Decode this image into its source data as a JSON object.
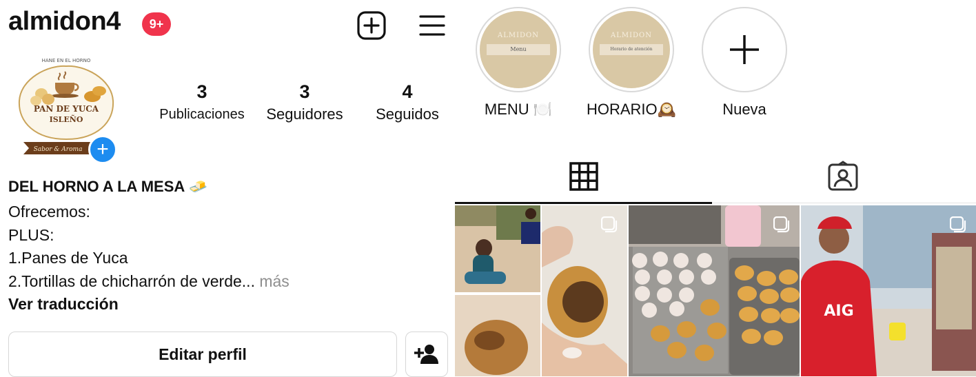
{
  "header": {
    "username": "almidon4",
    "notification_badge": "9+"
  },
  "profile": {
    "avatar": {
      "top_text": "HANE EN EL HORNO",
      "line1": "PAN DE YUCA",
      "line2": "ISLEÑO",
      "ribbon": "Sabor & Aroma"
    },
    "stats": [
      {
        "value": "3",
        "label": "Publicaciones"
      },
      {
        "value": "3",
        "label": "Seguidores"
      },
      {
        "value": "4",
        "label": "Seguidos"
      }
    ],
    "bio": {
      "name": "DEL HORNO A LA MESA",
      "name_emoji": "🧈",
      "lines": [
        "Ofrecemos:",
        "PLUS:",
        "1.Panes de Yuca",
        "2.Tortillas de chicharrón de verde..."
      ],
      "more": "más",
      "translate": "Ver traducción"
    },
    "edit_button": "Editar perfil"
  },
  "highlights": [
    {
      "label": "MENU 🍽️",
      "cover_brand": "ALMIDON",
      "cover_text": "Menu"
    },
    {
      "label": "HORARIO🕰️",
      "cover_brand": "ALMIDON",
      "cover_text": "Horario de atención"
    },
    {
      "label": "Nueva"
    }
  ],
  "grid_tiles": [
    {
      "alt": "people sitting on beach and pan de yuca",
      "multi": false
    },
    {
      "alt": "hand holding broken pastry",
      "multi": true
    },
    {
      "alt": "tray of dough balls and baked buns",
      "multi": true
    },
    {
      "alt": "man in red shirt at food cart",
      "multi": true
    }
  ],
  "colors": {
    "badge": "#f0344c",
    "add_story": "#1d8cf0",
    "highlight_cover": "#d9c8a5"
  }
}
